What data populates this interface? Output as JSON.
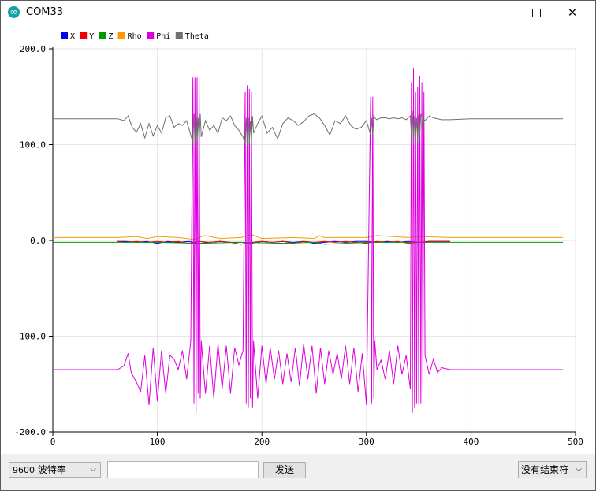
{
  "window": {
    "title": "COM33",
    "icon": "arduino-icon"
  },
  "chart_data": {
    "type": "line",
    "title": "",
    "xlabel": "",
    "ylabel": "",
    "xlim": [
      0,
      500
    ],
    "ylim": [
      -200,
      200
    ],
    "x_ticks": [
      0,
      100,
      200,
      300,
      400,
      500
    ],
    "y_ticks": [
      -200,
      -100,
      0,
      100,
      200
    ],
    "x_tick_labels": [
      "0",
      "100",
      "200",
      "300",
      "400",
      "500"
    ],
    "y_tick_labels": [
      "-200.0",
      "-100.0",
      "0.0",
      "100.0",
      "200.0"
    ],
    "grid": true,
    "legend": "top-left",
    "series": [
      {
        "name": "X",
        "color": "#0000ee",
        "x": [
          62,
          70,
          80,
          90,
          100,
          110,
          120,
          130,
          140,
          150,
          160,
          170,
          180,
          190,
          200,
          210,
          220,
          230,
          240,
          250,
          260,
          270,
          280,
          290,
          300,
          310,
          320,
          330,
          340,
          350,
          360,
          370,
          380
        ],
        "y": [
          -1,
          -1,
          -2,
          -1,
          -3,
          -1,
          -2,
          -1,
          -3,
          -2,
          -1,
          -2,
          -2,
          -3,
          -1,
          -2,
          -1,
          -2,
          -1,
          -3,
          -2,
          -1,
          -2,
          -1,
          -1,
          -2,
          -1,
          -2,
          -1,
          -2,
          -1,
          -1,
          -1
        ]
      },
      {
        "name": "Y",
        "color": "#ee0000",
        "x": [
          62,
          70,
          80,
          90,
          100,
          110,
          120,
          130,
          140,
          150,
          160,
          170,
          180,
          190,
          200,
          210,
          220,
          230,
          240,
          250,
          260,
          270,
          280,
          290,
          300,
          310,
          320,
          330,
          340,
          350,
          360,
          370,
          380
        ],
        "y": [
          -1,
          -2,
          -1,
          -2,
          -1,
          -2,
          -1,
          -3,
          -1,
          -2,
          -1,
          -2,
          -4,
          -2,
          -1,
          -2,
          -1,
          -3,
          -1,
          -2,
          -1,
          -2,
          -1,
          -2,
          -3,
          -1,
          -2,
          -1,
          -3,
          -2,
          -1,
          -1,
          -1
        ]
      },
      {
        "name": "Z",
        "color": "#009900",
        "x": [
          0,
          62,
          100,
          140,
          180,
          220,
          250,
          260,
          300,
          340,
          380,
          420,
          460,
          488
        ],
        "y": [
          -2,
          -2,
          -2,
          -3,
          -2,
          -3,
          -2,
          -4,
          -2,
          -2,
          -2,
          -2,
          -2,
          -2
        ]
      },
      {
        "name": "Rho",
        "color": "#ff9900",
        "x": [
          0,
          62,
          80,
          90,
          100,
          120,
          135,
          145,
          160,
          180,
          190,
          200,
          230,
          250,
          255,
          260,
          300,
          310,
          340,
          350,
          380,
          420,
          460,
          488
        ],
        "y": [
          3,
          3,
          4,
          2,
          4,
          3,
          1,
          5,
          2,
          3,
          6,
          2,
          3,
          2,
          5,
          3,
          3,
          5,
          3,
          4,
          3,
          3,
          3,
          3
        ]
      },
      {
        "name": "Phi",
        "color": "#dd00dd",
        "x": [
          0,
          40,
          62,
          68,
          72,
          75,
          80,
          84,
          88,
          92,
          96,
          100,
          104,
          108,
          112,
          116,
          120,
          124,
          128,
          132,
          134,
          135,
          136,
          137,
          138,
          139,
          140,
          141,
          142,
          146,
          150,
          154,
          158,
          162,
          166,
          170,
          174,
          178,
          182,
          184,
          185,
          186,
          187,
          188,
          189,
          190,
          191,
          192,
          196,
          200,
          204,
          208,
          212,
          216,
          220,
          224,
          228,
          232,
          236,
          240,
          244,
          248,
          252,
          256,
          260,
          264,
          268,
          272,
          276,
          280,
          284,
          288,
          292,
          296,
          300,
          304,
          305,
          306,
          307,
          308,
          310,
          314,
          318,
          322,
          326,
          330,
          334,
          338,
          342,
          343,
          344,
          345,
          346,
          347,
          348,
          349,
          350,
          351,
          352,
          353,
          354,
          355,
          356,
          360,
          364,
          368,
          372,
          380,
          400,
          440,
          488
        ],
        "y": [
          -135,
          -135,
          -135,
          -131,
          -118,
          -138,
          -148,
          -158,
          -120,
          -172,
          -112,
          -168,
          -115,
          -160,
          -120,
          -124,
          -135,
          -115,
          -145,
          -105,
          170,
          -170,
          170,
          -180,
          170,
          -160,
          170,
          -165,
          -105,
          -160,
          -110,
          -165,
          -108,
          -155,
          -110,
          -160,
          -112,
          -130,
          -115,
          155,
          -170,
          162,
          -175,
          158,
          -165,
          155,
          -175,
          -105,
          -165,
          -110,
          -150,
          -112,
          -145,
          -115,
          -150,
          -118,
          -148,
          -112,
          -152,
          -108,
          -145,
          -110,
          -160,
          -112,
          -150,
          -115,
          -140,
          -118,
          -145,
          -110,
          -150,
          -112,
          -158,
          -118,
          -172,
          150,
          -170,
          150,
          -165,
          -105,
          -135,
          -125,
          -145,
          -115,
          -150,
          -110,
          -140,
          -120,
          -155,
          165,
          -180,
          180,
          -175,
          155,
          -170,
          160,
          -170,
          172,
          -170,
          165,
          -160,
          155,
          -120,
          -140,
          -124,
          -138,
          -133,
          -135,
          -135,
          -135,
          -135
        ]
      },
      {
        "name": "Theta",
        "color": "#707070",
        "x": [
          0,
          40,
          62,
          68,
          72,
          76,
          80,
          84,
          88,
          92,
          96,
          100,
          104,
          108,
          112,
          116,
          120,
          124,
          128,
          132,
          134,
          135,
          136,
          137,
          138,
          139,
          140,
          141,
          142,
          146,
          150,
          154,
          158,
          162,
          166,
          170,
          174,
          178,
          182,
          184,
          185,
          186,
          187,
          188,
          189,
          190,
          191,
          192,
          196,
          200,
          205,
          210,
          215,
          220,
          225,
          230,
          235,
          240,
          245,
          250,
          255,
          260,
          265,
          270,
          275,
          280,
          285,
          290,
          295,
          300,
          304,
          305,
          306,
          307,
          308,
          310,
          314,
          318,
          322,
          326,
          330,
          334,
          338,
          342,
          343,
          344,
          345,
          346,
          347,
          348,
          349,
          350,
          351,
          352,
          353,
          354,
          355,
          356,
          360,
          364,
          368,
          372,
          380,
          400,
          440,
          488
        ],
        "y": [
          127,
          127,
          127,
          125,
          130,
          118,
          113,
          122,
          107,
          122,
          109,
          120,
          112,
          128,
          130,
          118,
          122,
          120,
          125,
          110,
          102,
          132,
          98,
          130,
          105,
          128,
          103,
          132,
          108,
          125,
          115,
          120,
          112,
          128,
          125,
          130,
          120,
          115,
          108,
          100,
          128,
          98,
          128,
          100,
          125,
          103,
          130,
          112,
          122,
          130,
          112,
          118,
          106,
          122,
          128,
          125,
          120,
          124,
          130,
          132,
          128,
          120,
          110,
          125,
          122,
          130,
          120,
          116,
          118,
          125,
          110,
          128,
          108,
          130,
          128,
          126,
          128,
          128,
          127,
          128,
          127,
          128,
          126,
          130,
          110,
          135,
          100,
          130,
          108,
          128,
          102,
          131,
          110,
          132,
          128,
          115,
          126,
          125,
          130,
          128,
          127,
          126,
          126,
          127,
          127,
          127
        ]
      }
    ]
  },
  "bottom_bar": {
    "baud_value": "9600",
    "baud_label": "波特率",
    "input_value": "",
    "send_label": "发送",
    "line_ending": "没有结束符"
  }
}
